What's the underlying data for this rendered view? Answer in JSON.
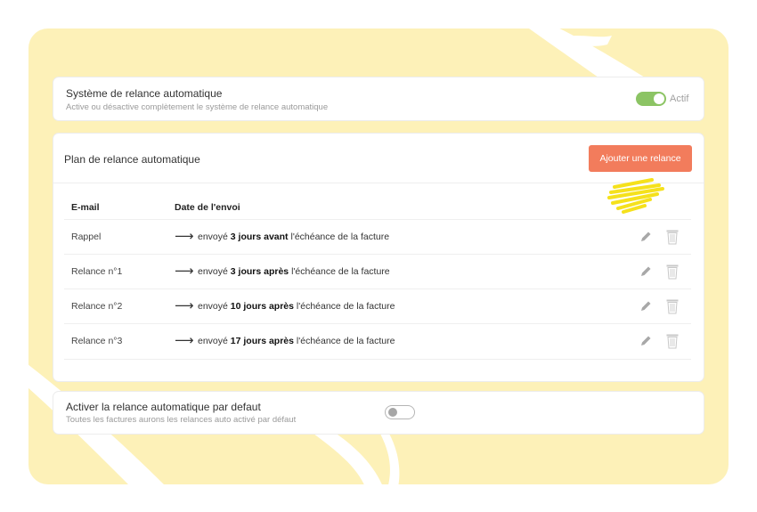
{
  "auto_reminder": {
    "title": "Système de relance automatique",
    "subtitle": "Active ou désactive complètement le système de relance automatique",
    "toggle_state": "on",
    "toggle_label": "Actif"
  },
  "plan": {
    "title": "Plan de relance automatique",
    "add_button": "Ajouter une relance",
    "columns": [
      "E-mail",
      "Date de l'envoi"
    ],
    "rows": [
      {
        "name": "Rappel",
        "prefix": "envoyé ",
        "bold": "3 jours avant",
        "suffix": " l'échéance de la facture"
      },
      {
        "name": "Relance n°1",
        "prefix": "envoyé ",
        "bold": "3 jours après",
        "suffix": " l'échéance de la facture"
      },
      {
        "name": "Relance n°2",
        "prefix": "envoyé ",
        "bold": "10 jours après",
        "suffix": " l'échéance de la facture"
      },
      {
        "name": "Relance n°3",
        "prefix": "envoyé ",
        "bold": "17 jours après",
        "suffix": " l'échéance de la facture"
      }
    ],
    "arrow": "⟶"
  },
  "default_reminder": {
    "title": "Activer la relance automatique par defaut",
    "subtitle": "Toutes les factures aurons les relances auto activé par défaut",
    "toggle_state": "off"
  },
  "colors": {
    "accent_button": "#f27c5c",
    "toggle_on": "#8cc464",
    "backdrop": "#fdf1b8",
    "highlight": "#f5e11c"
  },
  "icons": [
    "pencil-icon",
    "trash-icon"
  ]
}
